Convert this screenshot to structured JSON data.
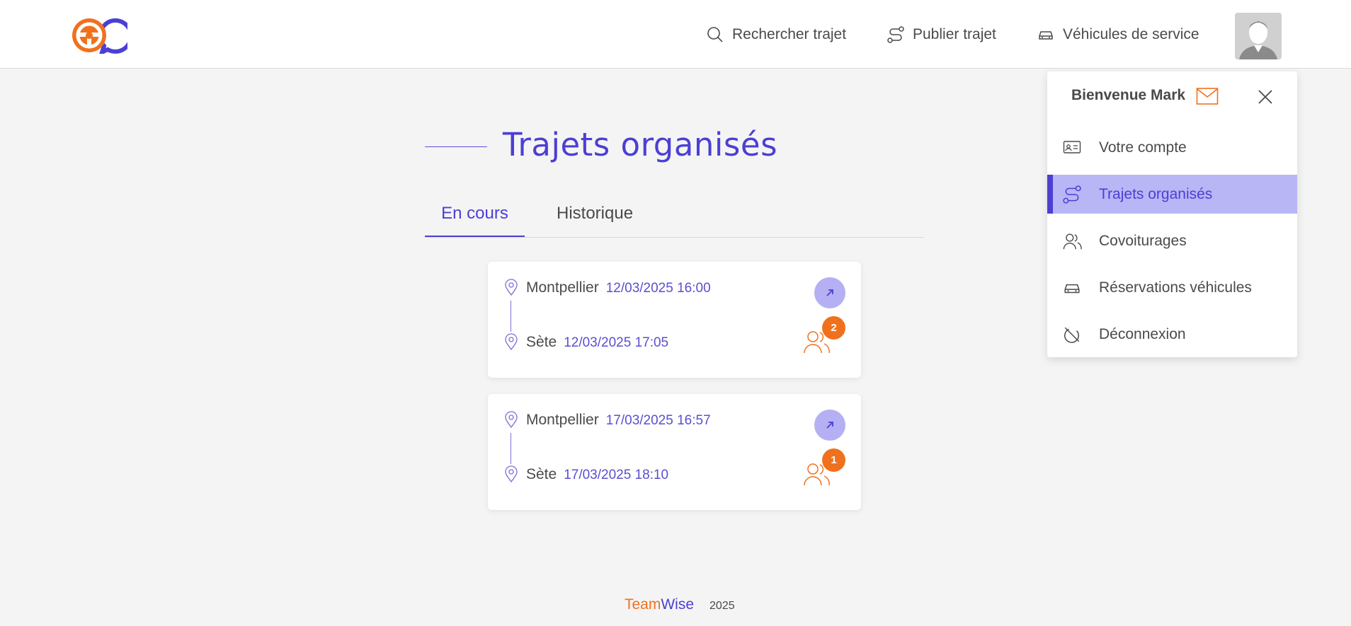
{
  "header": {
    "nav": [
      {
        "label": "Rechercher trajet",
        "icon": "search-icon"
      },
      {
        "label": "Publier trajet",
        "icon": "route-icon"
      },
      {
        "label": "Véhicules de service",
        "icon": "car-icon"
      }
    ]
  },
  "page": {
    "title": "Trajets organisés",
    "tabs": [
      {
        "label": "En cours",
        "active": true
      },
      {
        "label": "Historique",
        "active": false
      }
    ]
  },
  "trips": [
    {
      "from": {
        "city": "Montpellier",
        "datetime": "12/03/2025 16:00"
      },
      "to": {
        "city": "Sète",
        "datetime": "12/03/2025 17:05"
      },
      "passengers": "2"
    },
    {
      "from": {
        "city": "Montpellier",
        "datetime": "17/03/2025 16:57"
      },
      "to": {
        "city": "Sète",
        "datetime": "17/03/2025 18:10"
      },
      "passengers": "1"
    }
  ],
  "menu": {
    "welcome": "Bienvenue Mark",
    "items": [
      {
        "label": "Votre compte",
        "icon": "id-card-icon"
      },
      {
        "label": "Trajets organisés",
        "icon": "route-icon",
        "active": true
      },
      {
        "label": "Covoiturages",
        "icon": "users-icon"
      },
      {
        "label": "Réservations véhicules",
        "icon": "car-icon"
      },
      {
        "label": "Déconnexion",
        "icon": "logout-icon"
      }
    ]
  },
  "footer": {
    "brand_a": "Team",
    "brand_b": "Wise",
    "year": "2025"
  },
  "colors": {
    "primary": "#4b3fd4",
    "accent": "#f0711d",
    "active_bg": "#b8b6f4",
    "background": "#f4f4f4"
  }
}
